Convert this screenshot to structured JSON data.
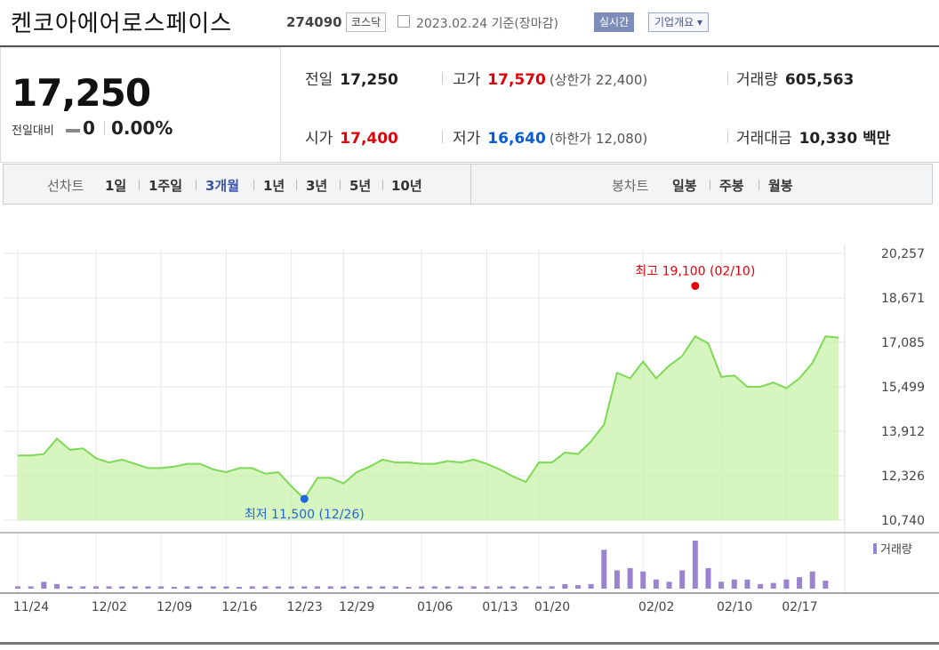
{
  "header": {
    "title": "켄코아에어로스페이스",
    "code": "274090",
    "market": "코스닥",
    "date": "2023.02.24 기준(장마감)",
    "realtime": "실시간",
    "overview": "기업개요 ▾"
  },
  "quote": {
    "price": "17,250",
    "change_label": "전일대비",
    "change": "0",
    "change_pct": "0.00%",
    "prev_close_label": "전일",
    "prev_close": "17,250",
    "open_label": "시가",
    "open": "17,400",
    "high_label": "고가",
    "high": "17,570",
    "upper_limit": "(상한가 22,400)",
    "low_label": "저가",
    "low": "16,640",
    "lower_limit": "(하한가 12,080)",
    "volume_label": "거래량",
    "volume": "605,563",
    "amount_label": "거래대금",
    "amount": "10,330",
    "amount_unit": "백만"
  },
  "periods": {
    "line_label": "선차트",
    "line_items": [
      "1일",
      "1주일",
      "3개월",
      "1년",
      "3년",
      "5년",
      "10년"
    ],
    "active": "3개월",
    "candle_label": "봉차트",
    "candle_items": [
      "일봉",
      "주봉",
      "월봉"
    ]
  },
  "chart_data": {
    "type": "area",
    "y_ticks": [
      "20,257",
      "18,671",
      "17,085",
      "15,499",
      "13,912",
      "12,326",
      "10,740"
    ],
    "ylim": [
      10740,
      20257
    ],
    "x_tick_labels": [
      "11/24",
      "12/02",
      "12/09",
      "12/16",
      "12/23",
      "12/29",
      "01/06",
      "01/13",
      "01/20",
      "02/02",
      "02/10",
      "02/17"
    ],
    "x_tick_index": [
      0,
      6,
      11,
      16,
      21,
      25,
      31,
      36,
      40,
      48,
      54,
      59
    ],
    "prices": [
      13050,
      13050,
      13100,
      13650,
      13250,
      13300,
      12950,
      12800,
      12900,
      12750,
      12600,
      12600,
      12650,
      12750,
      12750,
      12550,
      12450,
      12600,
      12600,
      12400,
      12450,
      11950,
      11500,
      12250,
      12250,
      12050,
      12450,
      12650,
      12900,
      12800,
      12800,
      12750,
      12750,
      12850,
      12800,
      12900,
      12750,
      12550,
      12300,
      12100,
      12800,
      12800,
      13150,
      13100,
      13550,
      14150,
      16000,
      15800,
      16400,
      15800,
      16250,
      16600,
      17300,
      17050,
      15850,
      15900,
      15500,
      15500,
      15650,
      15450,
      15800,
      16350,
      17300,
      17250
    ],
    "volumes": [
      1,
      1,
      3,
      2,
      1,
      1,
      1,
      1,
      1,
      1,
      1,
      1,
      0.6,
      1,
      1,
      1,
      1,
      0.6,
      1,
      1,
      1,
      1,
      1,
      1,
      1,
      1,
      1,
      1,
      1,
      1,
      0.6,
      1,
      1,
      1,
      1,
      1,
      1,
      1,
      1,
      1,
      1,
      1,
      2,
      1.5,
      2,
      17,
      8,
      9,
      7.5,
      4,
      3,
      8,
      21,
      9,
      3,
      4,
      4,
      2,
      2.5,
      4,
      5,
      7.5,
      3.5
    ],
    "max_label": "최고 19,100 (02/10)",
    "max_value": 19100,
    "min_label": "최저 11,500 (12/26)",
    "min_value": 11500,
    "volume_legend": "거래량",
    "line_color": "#7ed957",
    "fill_color": "#c9f2a8",
    "bar_color": "#9b84cf",
    "max_color": "#e0000a",
    "min_color": "#2266dd"
  }
}
